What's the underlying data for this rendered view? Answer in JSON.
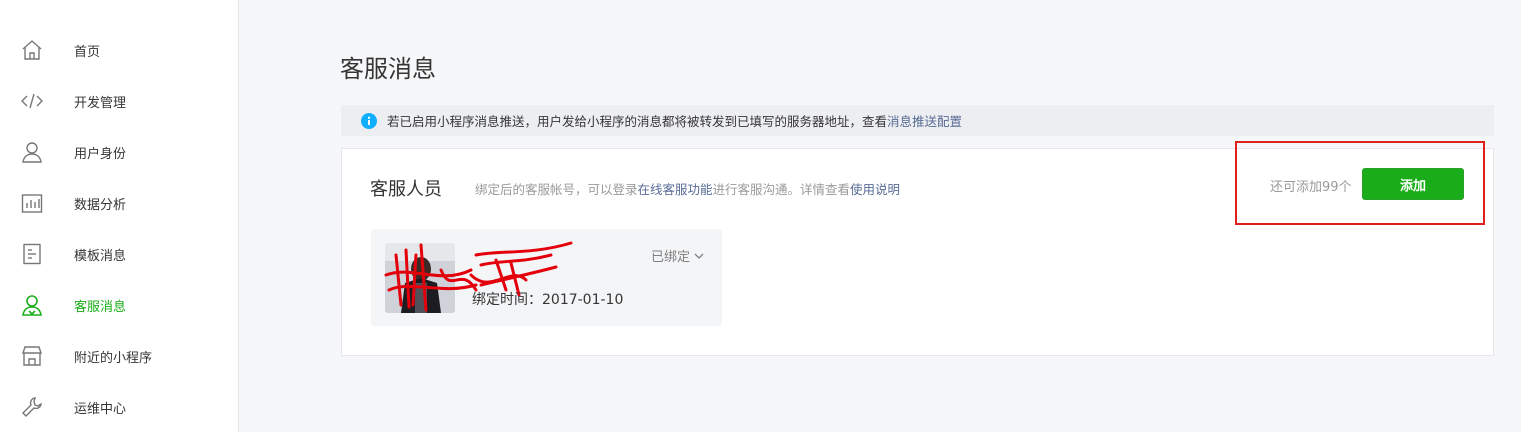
{
  "sidebar": {
    "items": [
      {
        "label": "首页",
        "icon": "home-icon"
      },
      {
        "label": "开发管理",
        "icon": "code-icon"
      },
      {
        "label": "用户身份",
        "icon": "user-icon"
      },
      {
        "label": "数据分析",
        "icon": "chart-icon"
      },
      {
        "label": "模板消息",
        "icon": "document-icon"
      },
      {
        "label": "客服消息",
        "icon": "customer-service-icon",
        "active": true
      },
      {
        "label": "附近的小程序",
        "icon": "store-icon"
      },
      {
        "label": "运维中心",
        "icon": "wrench-icon"
      }
    ]
  },
  "main": {
    "title": "客服消息",
    "notice": {
      "text": "若已启用小程序消息推送，用户发给小程序的消息都将被转发到已填写的服务器地址，查看",
      "link": "消息推送配置"
    },
    "card": {
      "title": "客服人员",
      "desc_prefix": "绑定后的客服帐号，可以登录",
      "desc_link1": "在线客服功能",
      "desc_middle": "进行客服沟通。详情查看",
      "desc_link2": "使用说明",
      "remaining": "还可添加99个",
      "add_button": "添加",
      "agent": {
        "status": "已绑定",
        "bind_time": "绑定时间：2017-01-10"
      }
    }
  },
  "colors": {
    "accent": "#1aad19",
    "link": "#576b95",
    "highlight": "#e0201c"
  }
}
